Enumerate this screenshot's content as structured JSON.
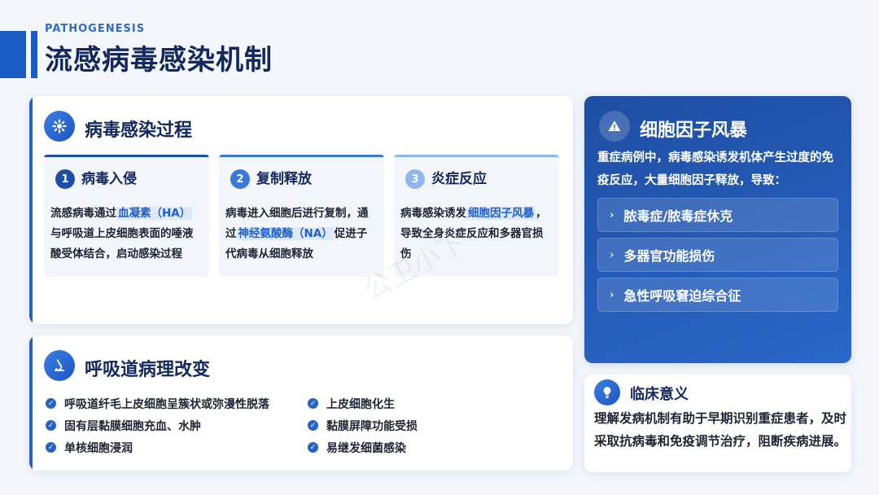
{
  "header": {
    "subtitle": "PATHOGENESIS",
    "title": "流感病毒感染机制"
  },
  "infection": {
    "title": "病毒感染过程",
    "icon": "gear-icon",
    "steps": [
      {
        "num": "1",
        "title": "病毒入侵",
        "pre": "流感病毒通过",
        "highlight": "血凝素（HA）",
        "post": "与呼吸道上皮细胞表面的唾液酸受体结合，启动感染过程",
        "color": "#1d4fa8"
      },
      {
        "num": "2",
        "title": "复制释放",
        "pre": "病毒进入细胞后进行复制，通过",
        "highlight": "神经氨酸酶（NA）",
        "post": "促进子代病毒从细胞释放",
        "color": "#3a78dc"
      },
      {
        "num": "3",
        "title": "炎症反应",
        "pre": "病毒感染诱发",
        "highlight": "细胞因子风暴",
        "post": "，导致全身炎症反应和多器官损伤",
        "color": "#8fb6ee"
      }
    ]
  },
  "pathology": {
    "title": "呼吸道病理改变",
    "icon": "microscope-icon",
    "left_items": [
      "呼吸道纤毛上皮细胞呈簇状或弥漫性脱落",
      "固有层黏膜细胞充血、水肿",
      "单核细胞浸润"
    ],
    "right_items": [
      "上皮细胞化生",
      "黏膜屏障功能受损",
      "易继发细菌感染"
    ]
  },
  "storm": {
    "title": "细胞因子风暴",
    "icon": "warning-icon",
    "desc": "重症病例中，病毒感染诱发机体产生过度的免疫反应，大量细胞因子释放，导致：",
    "items": [
      "脓毒症/脓毒症休克",
      "多器官功能损伤",
      "急性呼吸窘迫综合征"
    ]
  },
  "clinical": {
    "title": "临床意义",
    "icon": "lightbulb-icon",
    "desc": "理解发病机制有助于早期识别重症患者，及时采取抗病毒和免疫调节治疗，阻断疾病进展。"
  },
  "watermark": "公卫小下"
}
